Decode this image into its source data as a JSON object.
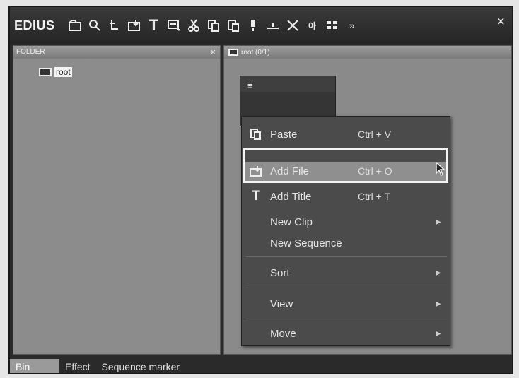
{
  "app_title": "EDIUS",
  "toolbar": {
    "buttons": [
      "new-folder-icon",
      "search-icon",
      "up-icon",
      "add-file-icon",
      "add-title-icon",
      "new-sequence-icon",
      "cut-icon",
      "copy-icon",
      "paste-icon",
      "add-to-player-icon",
      "add-to-timeline-icon",
      "delete-icon",
      "properties-icon",
      "view-icon",
      "more-icon"
    ],
    "close": "×"
  },
  "folder_pane": {
    "header": "FOLDER",
    "close": "×",
    "root_label": "root"
  },
  "clip_pane": {
    "header": "root (0/1)"
  },
  "context_menu": {
    "items": [
      {
        "label": "Paste",
        "shortcut": "Ctrl + V",
        "icon": "paste-icon"
      },
      {
        "label": "Add File",
        "shortcut": "Ctrl + O",
        "icon": "add-file-icon"
      },
      {
        "label": "Add Title",
        "shortcut": "Ctrl + T",
        "icon": "add-title-icon"
      },
      {
        "label": "New Clip",
        "shortcut": "",
        "icon": ""
      },
      {
        "label": "New Sequence",
        "shortcut": "",
        "icon": ""
      },
      {
        "label": "Sort",
        "shortcut": "",
        "icon": ""
      },
      {
        "label": "View",
        "shortcut": "",
        "icon": ""
      },
      {
        "label": "Move",
        "shortcut": "",
        "icon": ""
      }
    ]
  },
  "tabs": [
    "Bin",
    "Effect",
    "Sequence marker"
  ]
}
